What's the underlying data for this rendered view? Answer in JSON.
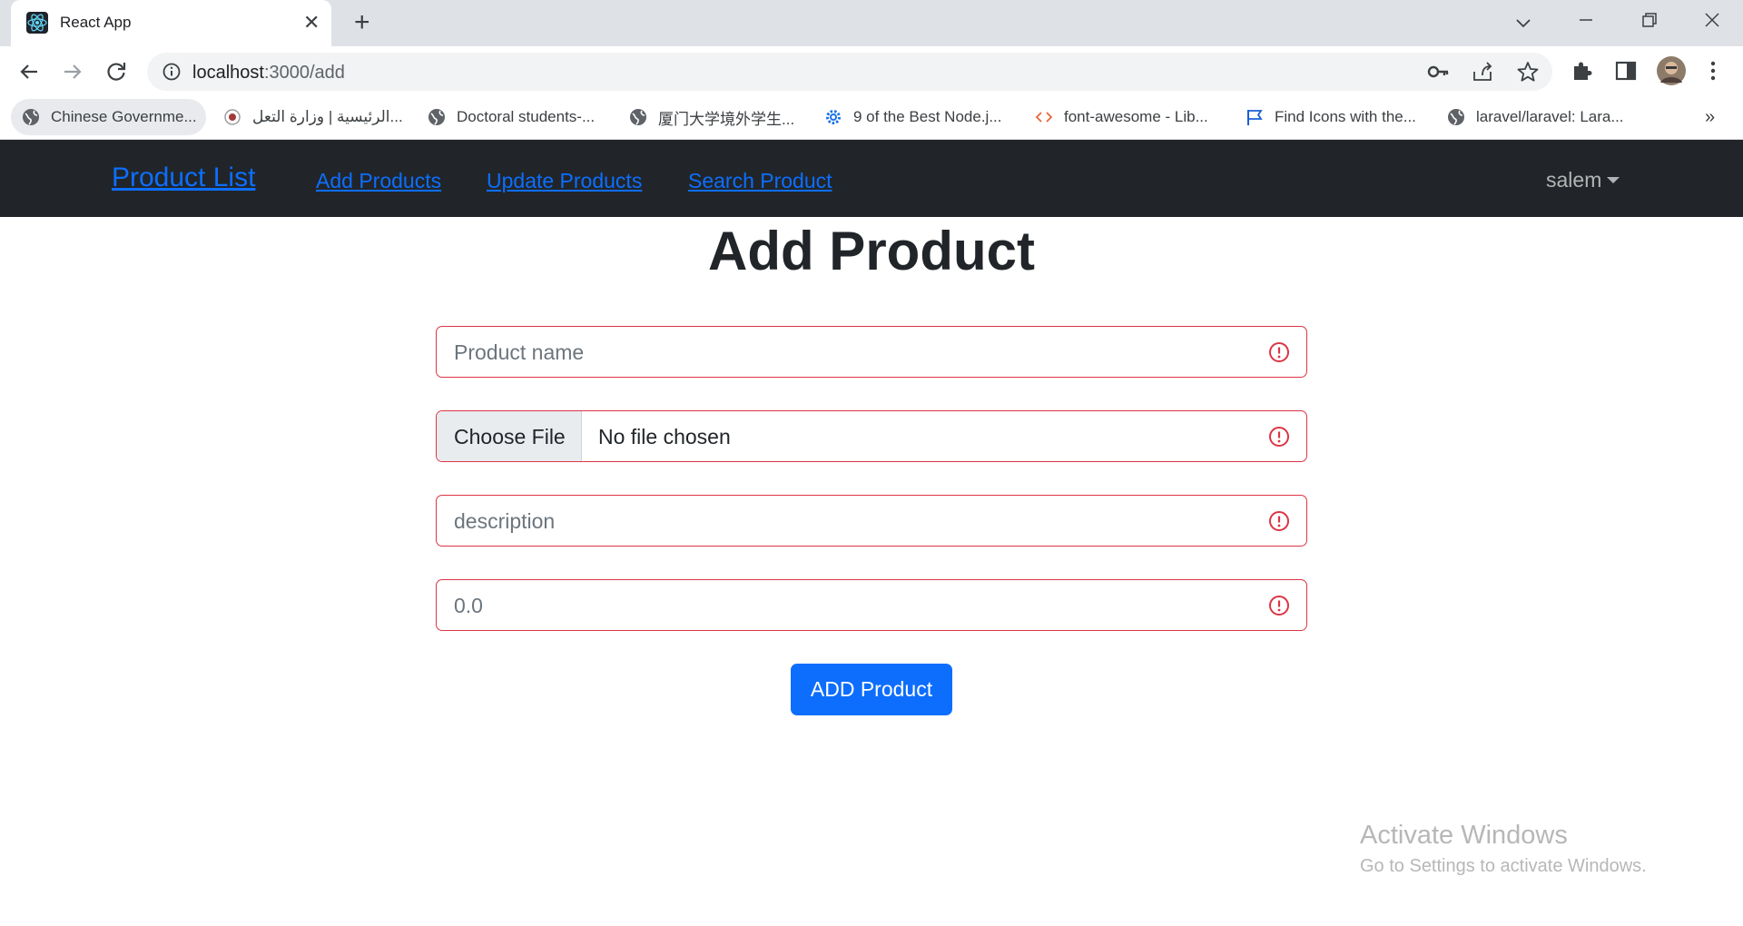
{
  "browser": {
    "tab_title": "React App",
    "url_host": "localhost",
    "url_path": ":3000/add",
    "bookmarks": [
      "Chinese Governme...",
      "الرئيسية | وزارة التعل...",
      "Doctoral students-...",
      "厦门大学境外学生...",
      "9 of the Best Node.j...",
      "font-awesome - Lib...",
      "Find Icons with the...",
      "laravel/laravel: Lara..."
    ],
    "more_bookmarks": "»"
  },
  "navbar": {
    "brand": "Product List",
    "links": [
      "Add Products",
      "Update Products",
      "Search Product"
    ],
    "user": "salem"
  },
  "form": {
    "heading": "Add Product",
    "name_placeholder": "Product name",
    "file_button": "Choose File",
    "file_status": "No file chosen",
    "description_placeholder": "description",
    "price_placeholder": "0.0",
    "submit_label": "ADD Product",
    "error_color": "#dc3545",
    "accent_color": "#0d6efd"
  },
  "watermark": {
    "line1": "Activate Windows",
    "line2": "Go to Settings to activate Windows."
  }
}
